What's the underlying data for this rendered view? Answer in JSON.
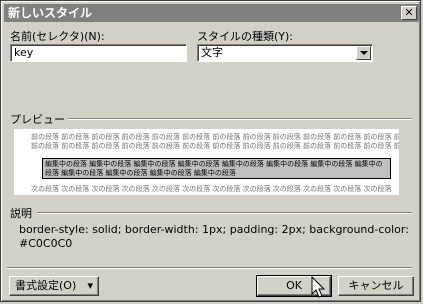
{
  "window": {
    "title": "新しいスタイル",
    "close_icon": "close-icon"
  },
  "name_field": {
    "label": "名前(セレクタ)(N):",
    "value": "key"
  },
  "type_field": {
    "label": "スタイルの種類(Y):",
    "value": "文字"
  },
  "preview": {
    "label": "プレビュー",
    "line_before": "前の段落 前の段落 前の段落 前の段落 前の段落 前の段落 前の段落 前の段落 前の段落 前の段落 前の段落 前の段落 前の段落 前の段落 前の段落 前の段落 前の段落 前の段落 前の段落",
    "styled_text": "編集中の段落 編集中の段落 編集中の段落 編集中の段落 編集中の段落 編集中の段落 編集中の段落 編集中の段落 編集中の段落 編集中の段落 編集中の段落 編集中の段落",
    "line_after": "次の段落 次の段落 次の段落 次の段落 次の段落 次の段落 次の段落 次の段落 次の段落 次の段落 次の段落 次の段落"
  },
  "description": {
    "label": "説明",
    "text": "border-style: solid; border-width: 1px; padding: 2px; background-color: #C0C0C0"
  },
  "buttons": {
    "format": "書式設定(O)",
    "format_arrow": "▾",
    "ok": "OK",
    "cancel": "キャンセル"
  }
}
